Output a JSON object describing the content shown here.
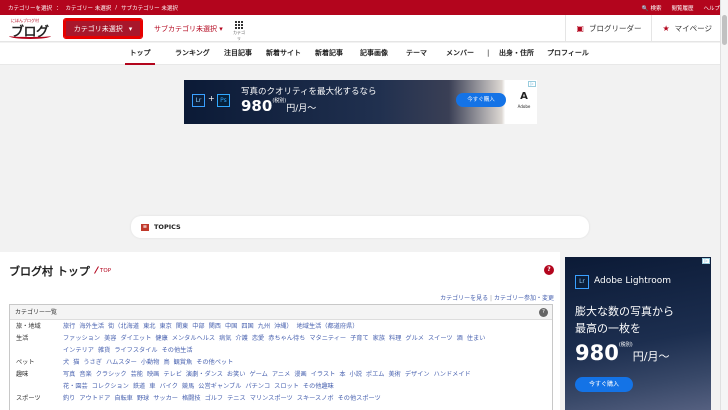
{
  "topbar": {
    "category_label": "カテゴリーを選択",
    "category_value": "カテゴリー 未選択",
    "subcategory_value": "サブカテゴリー 未選択",
    "search": "検索",
    "history": "閲覧履歴",
    "help": "ヘルプ"
  },
  "header": {
    "logo_small": "にほんブログ村",
    "logo": "ブログ村",
    "category_select": "カテゴリ未選択",
    "subcategory_select": "サブカテゴリ未選択",
    "grid_label": "カテゴリ",
    "blog_reader": "ブログリーダー",
    "my_page": "マイページ"
  },
  "nav": [
    "トップ",
    "ランキング",
    "注目記事",
    "新着サイト",
    "新着記事",
    "記事画像",
    "テーマ",
    "メンバー",
    "|",
    "出身・住所",
    "プロフィール"
  ],
  "ad_banner": {
    "lr": "Lr",
    "ps": "Ps",
    "headline": "写真のクオリティを最大化するなら",
    "price": "980",
    "tax": "(税別)",
    "unit": "円/月〜",
    "button": "今すぐ購入",
    "brand": "Adobe"
  },
  "topics_label": "TOPICS",
  "main": {
    "title": "ブログ村 トップ",
    "top_link": "TOP",
    "view_categories": "カテゴリーを見る",
    "join_change": "カテゴリー参加・変更",
    "category_list_title": "カテゴリー一覧",
    "categories": [
      {
        "label": "旅・地域",
        "links": [
          "旅行",
          "海外生活",
          "街（北海道",
          "東北",
          "東京",
          "関東",
          "中部",
          "関西",
          "中国",
          "四国",
          "九州",
          "沖縄）",
          "地域生活（都道府県）"
        ]
      },
      {
        "label": "生活",
        "links": [
          "ファッション",
          "美容",
          "ダイエット",
          "健康",
          "メンタルヘルス",
          "病気",
          "介護",
          "恋愛",
          "赤ちゃん待ち",
          "マタニティー",
          "子育て",
          "家族",
          "料理",
          "グルメ",
          "スイーツ",
          "酒",
          "住まい"
        ]
      },
      {
        "label": "",
        "links": [
          "インテリア",
          "雑貨",
          "ライフスタイル",
          "その他生活"
        ]
      },
      {
        "label": "ペット",
        "links": [
          "犬",
          "猫",
          "うさぎ",
          "ハムスター",
          "小動物",
          "鳥",
          "観賞魚",
          "その他ペット"
        ]
      },
      {
        "label": "趣味",
        "links": [
          "写真",
          "音楽",
          "クラシック",
          "芸能",
          "映画",
          "テレビ",
          "演劇・ダンス",
          "お笑い",
          "ゲーム",
          "アニメ",
          "漫画",
          "イラスト",
          "本",
          "小説",
          "ポエム",
          "美術",
          "デザイン",
          "ハンドメイド"
        ]
      },
      {
        "label": "",
        "links": [
          "花・園芸",
          "コレクション",
          "鉄道",
          "車",
          "バイク",
          "競馬",
          "公営ギャンブル",
          "パチンコ",
          "スロット",
          "その他趣味"
        ]
      },
      {
        "label": "スポーツ",
        "links": [
          "釣り",
          "アウトドア",
          "自転車",
          "野球",
          "サッカー",
          "格闘技",
          "ゴルフ",
          "テニス",
          "マリンスポーツ",
          "スキースノボ",
          "その他スポーツ"
        ]
      }
    ]
  },
  "side_ad": {
    "lr": "Lr",
    "name": "Adobe Lightroom",
    "line1": "膨大な数の写真から",
    "line2": "最高の一枚を",
    "price": "980",
    "tax": "(税別)",
    "unit": "円/月〜",
    "button": "今すぐ購入"
  },
  "colors": {
    "brand": "#b3051d",
    "link": "#4a63b0",
    "ad_blue": "#1473e6"
  }
}
